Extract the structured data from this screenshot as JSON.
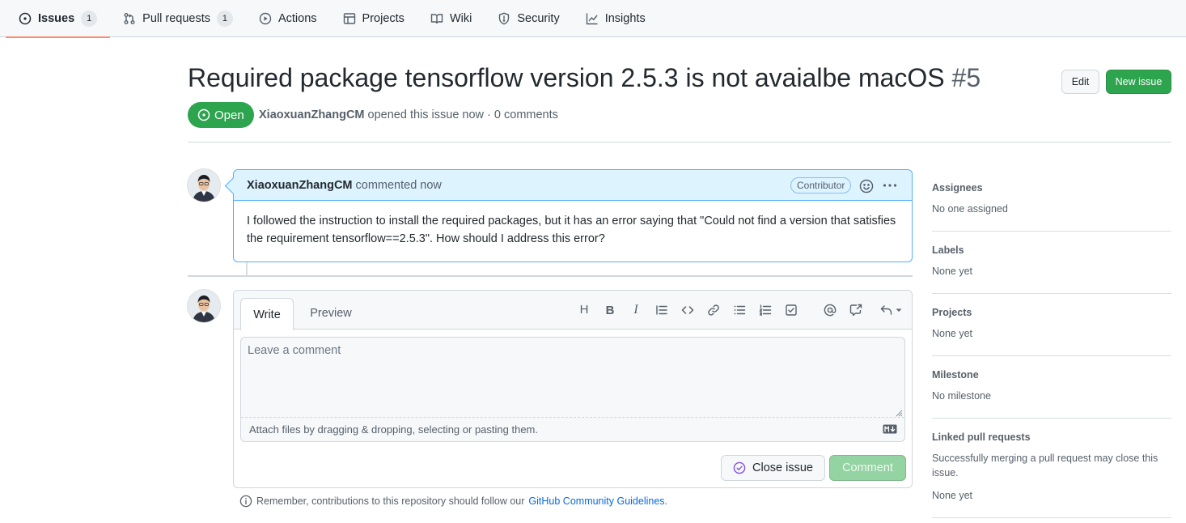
{
  "repo_nav": {
    "tabs": [
      {
        "label": "Issues",
        "count": "1",
        "icon": "issue-opened-icon",
        "selected": true
      },
      {
        "label": "Pull requests",
        "count": "1",
        "icon": "git-pull-request-icon"
      },
      {
        "label": "Actions",
        "icon": "play-icon"
      },
      {
        "label": "Projects",
        "icon": "table-icon"
      },
      {
        "label": "Wiki",
        "icon": "book-icon"
      },
      {
        "label": "Security",
        "icon": "shield-icon"
      },
      {
        "label": "Insights",
        "icon": "graph-icon"
      }
    ]
  },
  "issue": {
    "title": "Required package tensorflow version 2.5.3 is not avaialbe macOS",
    "number": "#5",
    "state": "Open",
    "author": "XiaoxuanZhangCM",
    "meta_text": "opened this issue now · 0 comments"
  },
  "header_buttons": {
    "edit": "Edit",
    "new_issue": "New issue"
  },
  "comment": {
    "author": "XiaoxuanZhangCM",
    "time_text": "commented now",
    "role_label": "Contributor",
    "body": "I followed the instruction to install the required packages, but it has an error saying that \"Could not find a version that satisfies the requirement tensorflow==2.5.3\". How should I address this error?"
  },
  "composer": {
    "tabs": {
      "write": "Write",
      "preview": "Preview"
    },
    "toolbar": {
      "heading": "H",
      "bold": "B",
      "italic": "I"
    },
    "placeholder": "Leave a comment",
    "drop_hint": "Attach files by dragging & dropping, selecting or pasting them.",
    "close_button": "Close issue",
    "comment_button": "Comment"
  },
  "guidelines": {
    "text": "Remember, contributions to this repository should follow our",
    "link": "GitHub Community Guidelines",
    "period": "."
  },
  "sidebar": {
    "assignees": {
      "heading": "Assignees",
      "value": "No one assigned"
    },
    "labels": {
      "heading": "Labels",
      "value": "None yet"
    },
    "projects": {
      "heading": "Projects",
      "value": "None yet"
    },
    "milestone": {
      "heading": "Milestone",
      "value": "No milestone"
    },
    "linked_prs": {
      "heading": "Linked pull requests",
      "note": "Successfully merging a pull request may close this issue.",
      "value": "None yet"
    }
  },
  "colors": {
    "open_green": "#2da44e",
    "accent_blue": "#0969da",
    "nav_underline": "#fd8c73",
    "close_purple": "#8250df"
  }
}
